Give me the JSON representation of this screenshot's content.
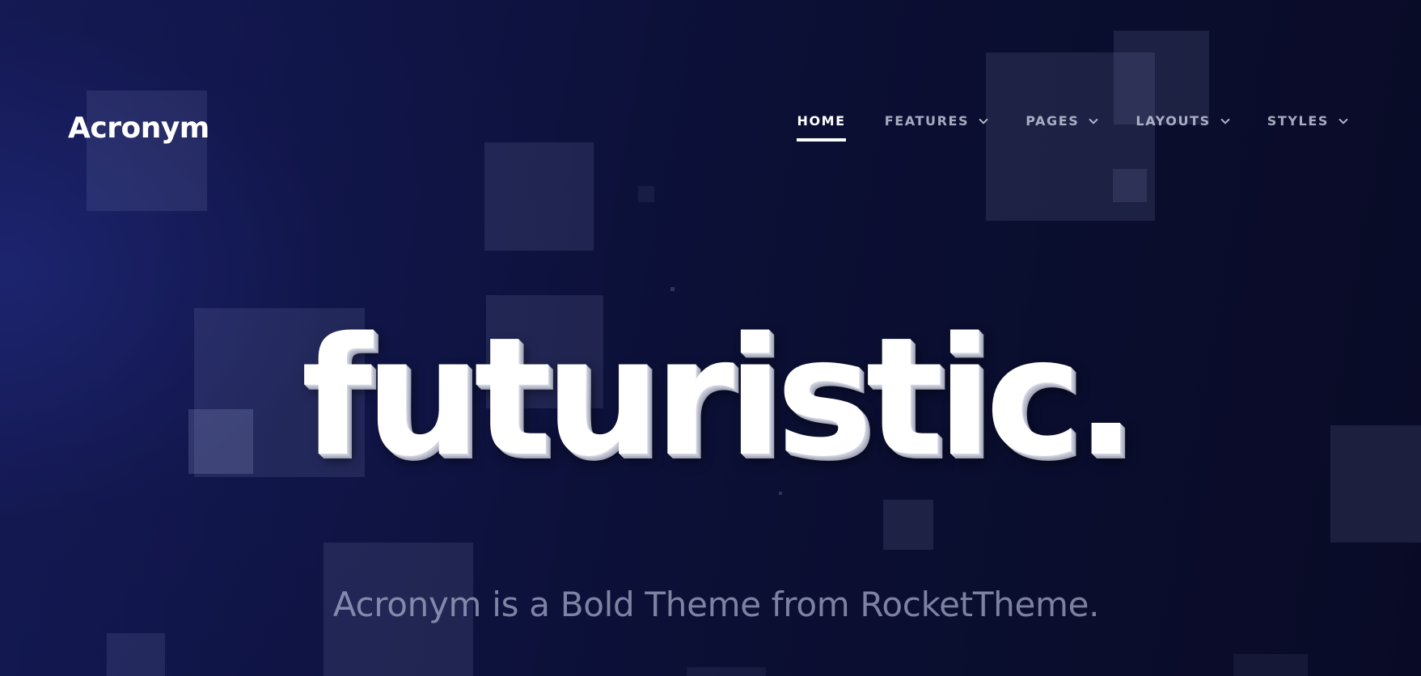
{
  "brand": {
    "name": "Acronym"
  },
  "nav": {
    "items": [
      {
        "label": "HOME",
        "active": true,
        "has_dropdown": false
      },
      {
        "label": "FEATURES",
        "active": false,
        "has_dropdown": true,
        "icon": "chevron-down-icon"
      },
      {
        "label": "PAGES",
        "active": false,
        "has_dropdown": true,
        "icon": "chevron-down-icon"
      },
      {
        "label": "LAYOUTS",
        "active": false,
        "has_dropdown": true,
        "icon": "chevron-down-icon"
      },
      {
        "label": "STYLES",
        "active": false,
        "has_dropdown": true,
        "icon": "chevron-down-icon"
      }
    ]
  },
  "hero": {
    "headline": "futuristic.",
    "tagline": "Acronym is a Bold Theme from RocketTheme."
  },
  "colors": {
    "background_dark": "#090b26",
    "background_accent": "#141a55",
    "text_primary": "#ffffff",
    "text_muted": "#aaafcd"
  }
}
